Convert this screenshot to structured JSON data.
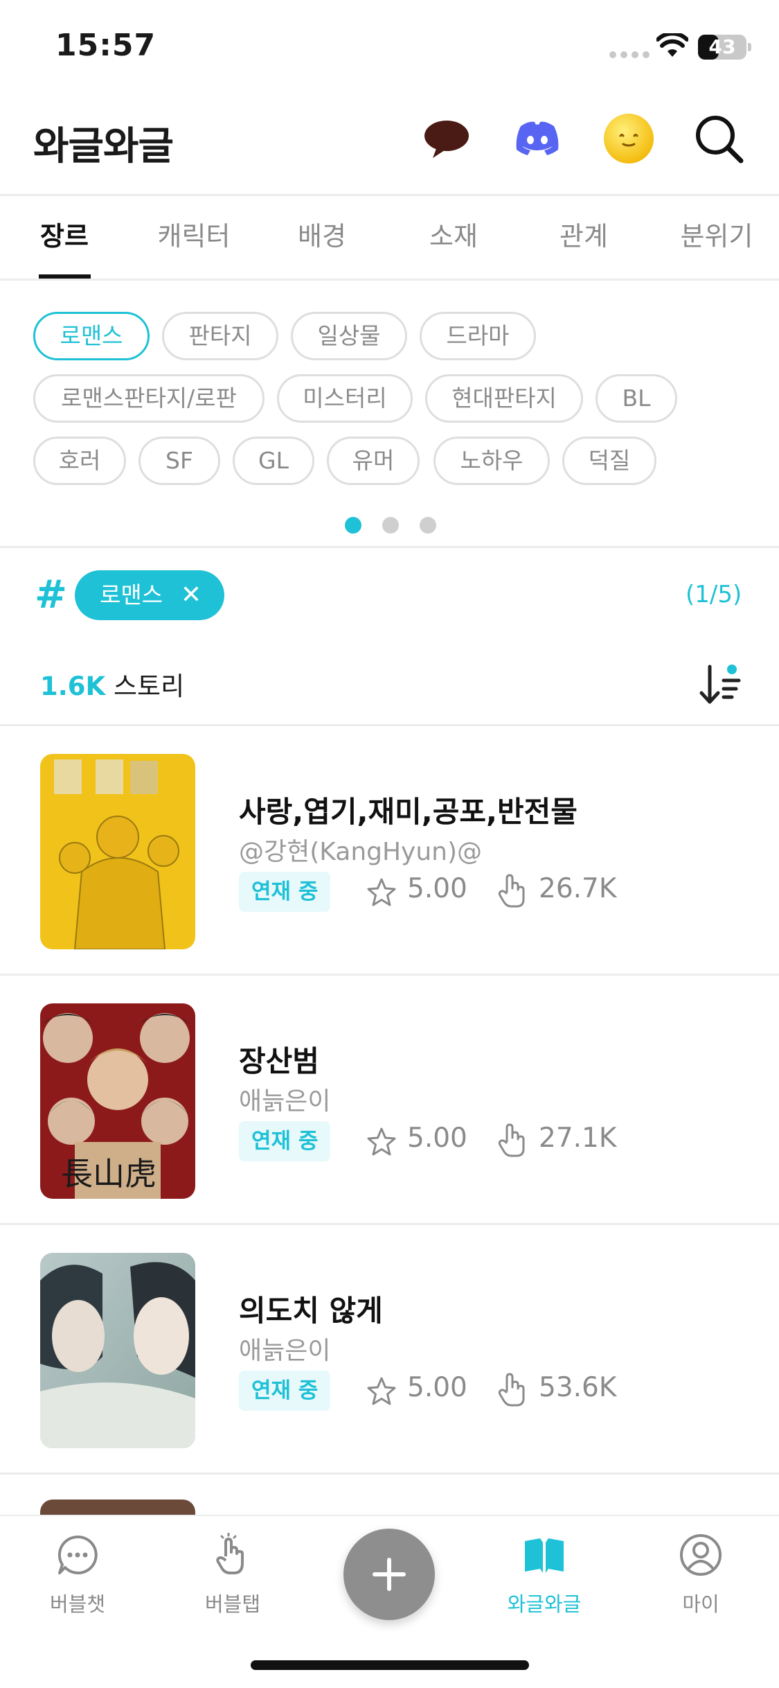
{
  "status_bar": {
    "time": "15:57",
    "battery_level": "43",
    "battery_fraction": 0.43
  },
  "header": {
    "title": "와글와글",
    "icons": [
      "chat-bubble-icon",
      "discord-icon",
      "smiley-emoji-icon",
      "search-icon"
    ]
  },
  "tabs": [
    {
      "label": "장르",
      "active": true
    },
    {
      "label": "캐릭터",
      "active": false
    },
    {
      "label": "배경",
      "active": false
    },
    {
      "label": "소재",
      "active": false
    },
    {
      "label": "관계",
      "active": false
    },
    {
      "label": "분위기",
      "active": false
    }
  ],
  "chips": [
    {
      "label": "로맨스",
      "active": true
    },
    {
      "label": "판타지"
    },
    {
      "label": "일상물"
    },
    {
      "label": "드라마"
    },
    {
      "label": "로맨스판타지/로판"
    },
    {
      "label": "미스터리"
    },
    {
      "label": "현대판타지"
    },
    {
      "label": "BL"
    },
    {
      "label": "호러"
    },
    {
      "label": "SF"
    },
    {
      "label": "GL"
    },
    {
      "label": "유머"
    },
    {
      "label": "노하우"
    },
    {
      "label": "덕질"
    }
  ],
  "chip_pages": {
    "count": 3,
    "active": 1
  },
  "filter": {
    "hash": "#",
    "selected": "로맨스",
    "close": "✕",
    "page_count": "(1/5)"
  },
  "summary": {
    "count": "1.6K",
    "label": "스토리"
  },
  "accent_color": "#1ec1d6",
  "stories": [
    {
      "title": "사랑,엽기,재미,공포,반전물",
      "author": "@강현(KangHyun)@",
      "status": "연재 중",
      "rating": "5.00",
      "views": "26.7K"
    },
    {
      "title": "장산범",
      "author": "애늙은이",
      "status": "연재 중",
      "rating": "5.00",
      "views": "27.1K"
    },
    {
      "title": "의도치 않게",
      "author": "애늙은이",
      "status": "연재 중",
      "rating": "5.00",
      "views": "53.6K"
    }
  ],
  "bottom_nav": [
    {
      "label": "버블챗",
      "icon": "chat-dots-icon",
      "active": false
    },
    {
      "label": "버블탭",
      "icon": "tap-hand-icon",
      "active": false
    },
    {
      "label": "와글와글",
      "icon": "open-book-icon",
      "active": true
    },
    {
      "label": "마이",
      "icon": "profile-icon",
      "active": false
    }
  ]
}
